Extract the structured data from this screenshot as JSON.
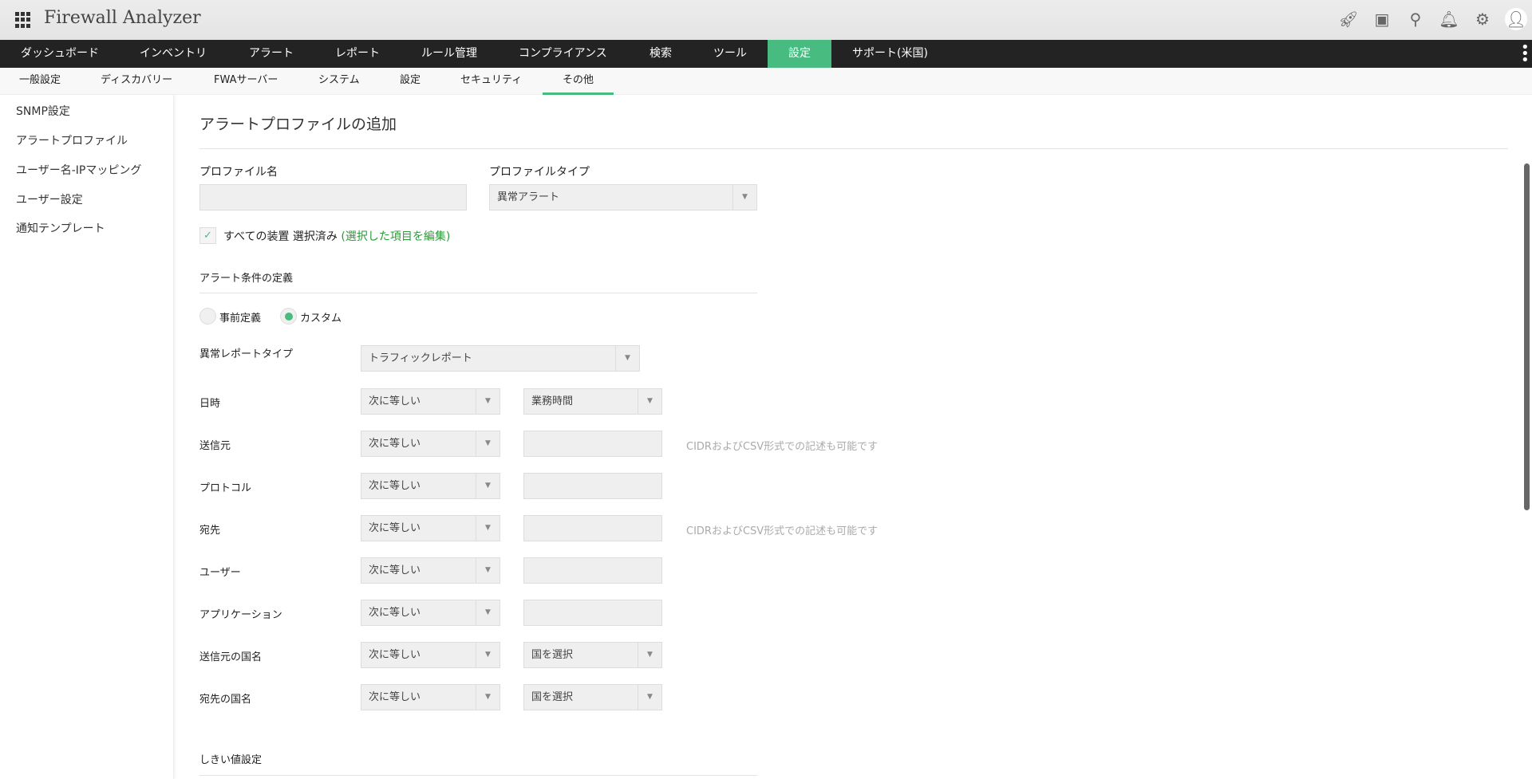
{
  "header": {
    "title": "Firewall Analyzer",
    "icons": [
      "rocket-icon",
      "presentation-icon",
      "search-icon",
      "bell-icon",
      "gear-icon",
      "user-avatar-icon"
    ]
  },
  "nav": {
    "items": [
      "ダッシュボード",
      "インベントリ",
      "アラート",
      "レポート",
      "ルール管理",
      "コンプライアンス",
      "検索",
      "ツール",
      "設定",
      "サポート(米国)"
    ],
    "active": "設定"
  },
  "subnav": {
    "items": [
      "一般設定",
      "ディスカバリー",
      "FWAサーバー",
      "システム",
      "設定",
      "セキュリティ",
      "その他"
    ],
    "active": "その他"
  },
  "sidebar": {
    "items": [
      "SNMP設定",
      "アラートプロファイル",
      "ユーザー名-IPマッピング",
      "ユーザー設定",
      "通知テンプレート"
    ]
  },
  "form": {
    "title": "アラートプロファイルの追加",
    "profile_name_label": "プロファイル名",
    "profile_name_value": "",
    "profile_type_label": "プロファイルタイプ",
    "profile_type_value": "異常アラート",
    "devices_text": "すべての装置 選択済み",
    "devices_edit": "(選択した項目を編集)",
    "criteria_heading": "アラート条件の定義",
    "radio_predefined": "事前定義",
    "radio_custom": "カスタム",
    "radio_selected": "カスタム",
    "report_type_label": "異常レポートタイプ",
    "report_type_value": "トラフィックレポート",
    "rows": [
      {
        "label": "日時",
        "op": "次に等しい",
        "value": "業務時間",
        "kind": "select"
      },
      {
        "label": "送信元",
        "op": "次に等しい",
        "value": "",
        "kind": "input",
        "hint": "CIDRおよびCSV形式での記述も可能です"
      },
      {
        "label": "プロトコル",
        "op": "次に等しい",
        "value": "",
        "kind": "input"
      },
      {
        "label": "宛先",
        "op": "次に等しい",
        "value": "",
        "kind": "input",
        "hint": "CIDRおよびCSV形式での記述も可能です"
      },
      {
        "label": "ユーザー",
        "op": "次に等しい",
        "value": "",
        "kind": "input"
      },
      {
        "label": "アプリケーション",
        "op": "次に等しい",
        "value": "",
        "kind": "input"
      },
      {
        "label": "送信元の国名",
        "op": "次に等しい",
        "value": "国を選択",
        "kind": "select"
      },
      {
        "label": "宛先の国名",
        "op": "次に等しい",
        "value": "国を選択",
        "kind": "select"
      }
    ],
    "threshold_heading": "しきい値設定"
  },
  "colors": {
    "accent": "#47bb80",
    "nav_bg": "#232323",
    "link_green": "#2b9a3a"
  }
}
